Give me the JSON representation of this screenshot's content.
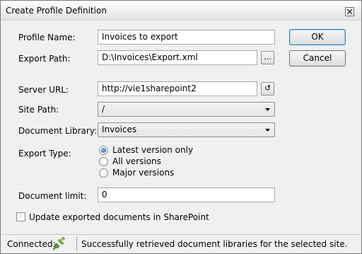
{
  "window": {
    "title": "Create Profile Definition"
  },
  "form": {
    "profile_name": {
      "label": "Profile Name:",
      "value": "Invoices to export"
    },
    "export_path": {
      "label": "Export Path:",
      "value": "D:\\Invoices\\Export.xml",
      "browse_label": "..."
    },
    "server_url": {
      "label": "Server URL:",
      "value": "http://vie1sharepoint2",
      "refresh_glyph": "↺"
    },
    "site_path": {
      "label": "Site Path:",
      "value": "/"
    },
    "document_library": {
      "label": "Document Library:",
      "value": "Invoices"
    },
    "export_type": {
      "label": "Export Type:",
      "options": [
        "Latest version only",
        "All versions",
        "Major versions"
      ],
      "selected": "Latest version only"
    },
    "document_limit": {
      "label": "Document limit:",
      "value": "0"
    },
    "update_checkbox": {
      "label": "Update exported documents in SharePoint",
      "checked": false
    }
  },
  "buttons": {
    "ok": "OK",
    "cancel": "Cancel"
  },
  "status": {
    "connected_label": "Connected:",
    "message": "Successfully retrieved document libraries for the selected site.",
    "connected_icon": "green-plug-icon"
  },
  "colors": {
    "default_button_border": "#3c7fb1",
    "plug_green": "#5aa02c"
  }
}
